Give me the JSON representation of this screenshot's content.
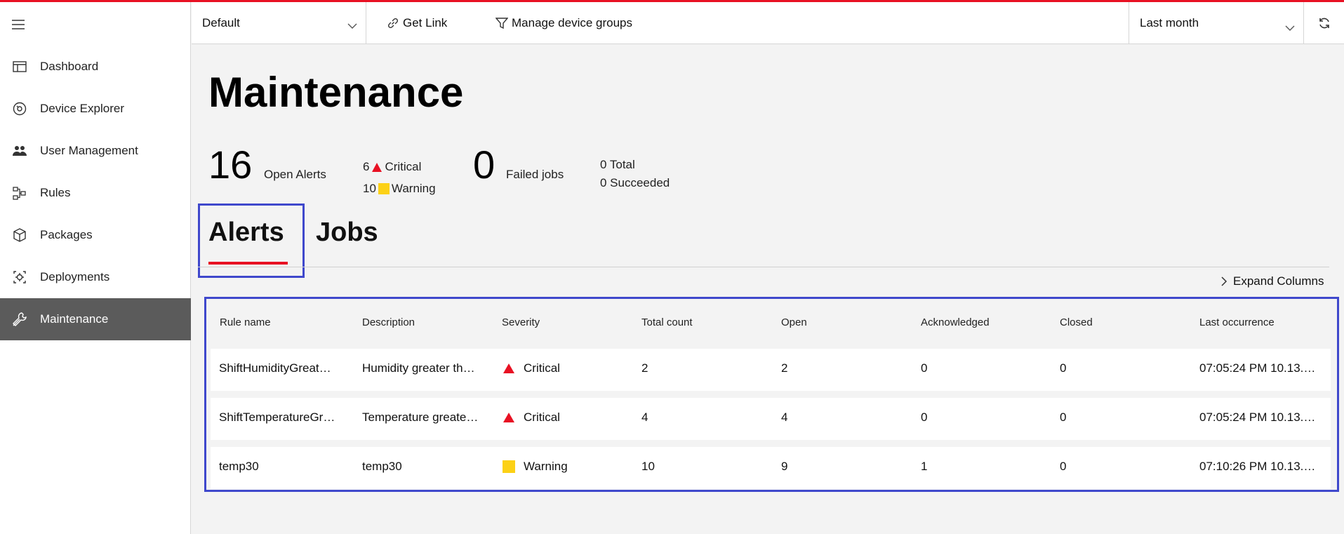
{
  "sidebar": {
    "items": [
      {
        "label": "Dashboard",
        "icon": "dashboard-icon"
      },
      {
        "label": "Device Explorer",
        "icon": "device-explorer-icon"
      },
      {
        "label": "User Management",
        "icon": "users-icon"
      },
      {
        "label": "Rules",
        "icon": "rules-icon"
      },
      {
        "label": "Packages",
        "icon": "package-icon"
      },
      {
        "label": "Deployments",
        "icon": "deployments-icon"
      },
      {
        "label": "Maintenance",
        "icon": "maintenance-icon"
      }
    ],
    "active_index": 6
  },
  "topbar": {
    "device_group": "Default",
    "get_link": "Get Link",
    "manage_groups": "Manage device groups",
    "time_range": "Last month"
  },
  "page": {
    "title": "Maintenance",
    "open_alerts_count": "16",
    "open_alerts_label": "Open Alerts",
    "critical_count": "6",
    "critical_label": "Critical",
    "warning_count": "10",
    "warning_label": "Warning",
    "failed_jobs_count": "0",
    "failed_jobs_label": "Failed jobs",
    "total_line": "0 Total",
    "succeeded_line": "0 Succeeded"
  },
  "tabs": [
    {
      "label": "Alerts",
      "active": true
    },
    {
      "label": "Jobs",
      "active": false
    }
  ],
  "expand_columns": "Expand Columns",
  "table": {
    "headers": [
      "Rule name",
      "Description",
      "Severity",
      "Total count",
      "Open",
      "Acknowledged",
      "Closed",
      "Last occurrence"
    ],
    "rows": [
      {
        "rule": "ShiftHumidityGreat…",
        "description": "Humidity greater th…",
        "severity": "Critical",
        "total": "2",
        "open": "2",
        "ack": "0",
        "closed": "0",
        "last": "07:05:24 PM 10.13.…"
      },
      {
        "rule": "ShiftTemperatureGr…",
        "description": "Temperature greate…",
        "severity": "Critical",
        "total": "4",
        "open": "4",
        "ack": "0",
        "closed": "0",
        "last": "07:05:24 PM 10.13.…"
      },
      {
        "rule": "temp30",
        "description": "temp30",
        "severity": "Warning",
        "total": "10",
        "open": "9",
        "ack": "1",
        "closed": "0",
        "last": "07:10:26 PM 10.13.…"
      }
    ]
  },
  "colors": {
    "accent_red": "#e81123",
    "highlight_blue": "#3f48cc",
    "critical": "#e81123",
    "warning": "#fcd116",
    "nav_active_bg": "#5b5b5b"
  }
}
